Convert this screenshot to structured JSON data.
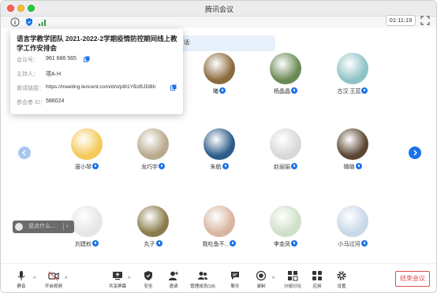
{
  "window": {
    "title": "腾讯会议"
  },
  "timer": "01:11:19",
  "popup": {
    "title": "语言学教学团队 2021-2022-2学期疫情防控期间线上教学工作安排会",
    "meeting_id_label": "会议号：",
    "meeting_id": "961 688 565",
    "host_label": "主持人：",
    "host": "项A·H",
    "link_label": "邀请链接：",
    "link": "https://meeting.tencent.com/dm/p8I1YBzBJDBh",
    "participant_id_label": "参会者 ID：",
    "participant_id": "586024"
  },
  "banner": {
    "text": "话:"
  },
  "participants": [
    {
      "name": "曦",
      "color": "#8a6a3e"
    },
    {
      "name": "杨晶晶",
      "color": "#6a8a55"
    },
    {
      "name": "古汉 王蕊",
      "color": "#8fc2c6"
    },
    {
      "name": "唐小琴",
      "color": "#f5c95a"
    },
    {
      "name": "龙巧宇",
      "color": "#b9a98e"
    },
    {
      "name": "朱航",
      "color": "#2d5c8a"
    },
    {
      "name": "赵丽娟",
      "color": "#d8d8d8"
    },
    {
      "name": "璐璐",
      "color": "#5b4632"
    },
    {
      "name": "刘建权",
      "color": "#e6e6e6"
    },
    {
      "name": "丸子",
      "color": "#8a7c4a"
    },
    {
      "name": "我吃鱼不...",
      "color": "#d8b5a0"
    },
    {
      "name": "李金凤",
      "color": "#cfe0c8"
    },
    {
      "name": "小马过河",
      "color": "#c8d8e8"
    }
  ],
  "chat": {
    "placeholder": "说点什么...",
    "arrow": "‹"
  },
  "toolbar": {
    "mute": "静音",
    "video": "开启视频",
    "share": "共享屏幕",
    "security": "安全",
    "invite": "邀请",
    "members": "管理成员(18)",
    "chat": "聊天",
    "record": "录制",
    "breakout": "分组讨论",
    "apps": "应用",
    "settings": "设置",
    "end": "结束会议"
  },
  "colors": {
    "accent": "#1b73e8",
    "danger": "#e34d4d"
  }
}
